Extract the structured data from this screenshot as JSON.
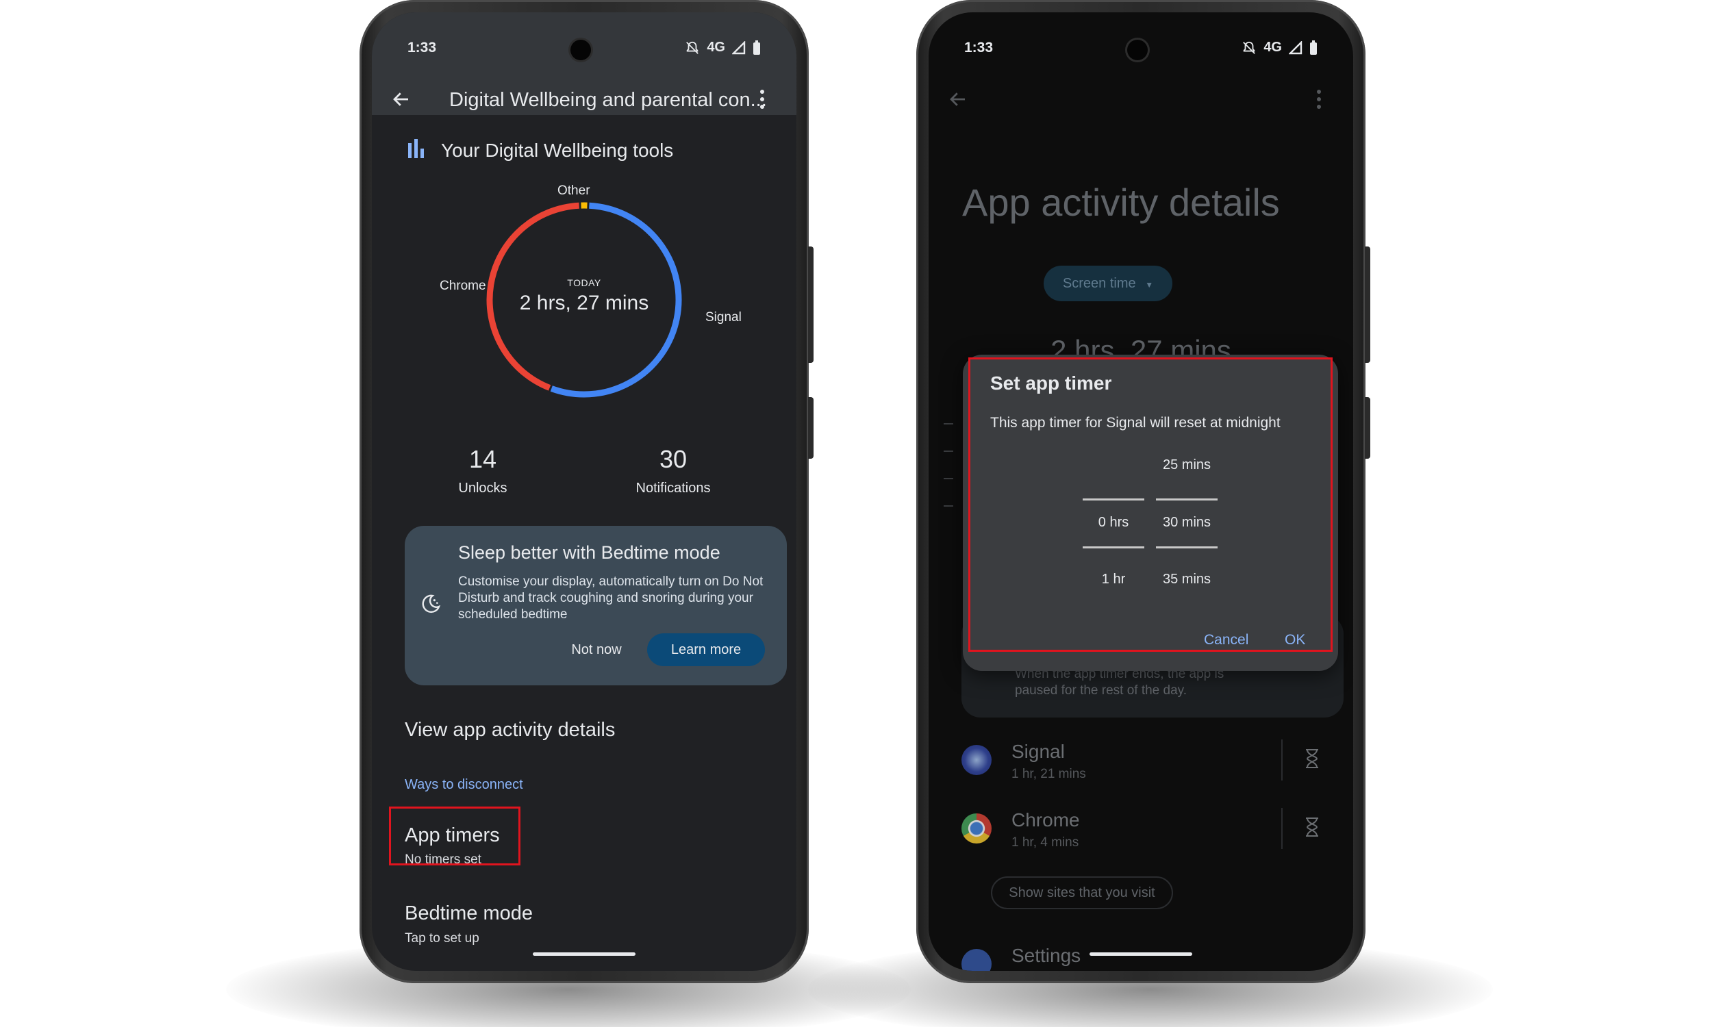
{
  "colors": {
    "accent": "#8ab4f8",
    "signal": "#4285f4",
    "chrome": "#ea4335",
    "other": "#fbbc04",
    "highlight": "#e0141e",
    "primary_button": "#0b4a78"
  },
  "left": {
    "status": {
      "time": "1:33",
      "network": "4G"
    },
    "appbar": {
      "title": "Digital Wellbeing and parental con..."
    },
    "tools_title": "Your Digital Wellbeing tools",
    "chart_data": {
      "type": "pie",
      "categories": [
        "Signal",
        "Chrome",
        "Other"
      ],
      "values": [
        81,
        64,
        2
      ],
      "center_small": "TODAY",
      "center_big": "2 hrs, 27 mins"
    },
    "stats": {
      "unlocks": {
        "value": "14",
        "label": "Unlocks"
      },
      "notifications": {
        "value": "30",
        "label": "Notifications"
      }
    },
    "card": {
      "title": "Sleep better with Bedtime mode",
      "body": "Customise your display, automatically turn on Do Not Disturb and track coughing and snoring during your scheduled bedtime",
      "not_now": "Not now",
      "learn_more": "Learn more"
    },
    "view_details": "View app activity details",
    "ways_header": "Ways to disconnect",
    "app_timers": {
      "title": "App timers",
      "subtitle": "No timers set"
    },
    "bedtime": {
      "title": "Bedtime mode",
      "subtitle": "Tap to set up"
    }
  },
  "right": {
    "status": {
      "time": "1:33",
      "network": "4G"
    },
    "page_title": "App activity details",
    "chip_label": "Screen time",
    "big_value": "2 hrs, 27 mins",
    "behind_text": "When the app timer ends, the app is paused for the rest of the day.",
    "apps": [
      {
        "name": "Signal",
        "usage": "1 hr, 21 mins"
      },
      {
        "name": "Chrome",
        "usage": "1 hr, 4 mins"
      }
    ],
    "show_sites": "Show sites that you visit",
    "settings_label": "Settings",
    "dialog": {
      "title": "Set app timer",
      "body": "This app timer for Signal will reset at midnight",
      "hours": {
        "prev": "",
        "selected": "0 hrs",
        "next": "1 hr"
      },
      "minutes": {
        "prev": "25 mins",
        "selected": "30 mins",
        "next": "35 mins"
      },
      "cancel": "Cancel",
      "ok": "OK"
    }
  }
}
